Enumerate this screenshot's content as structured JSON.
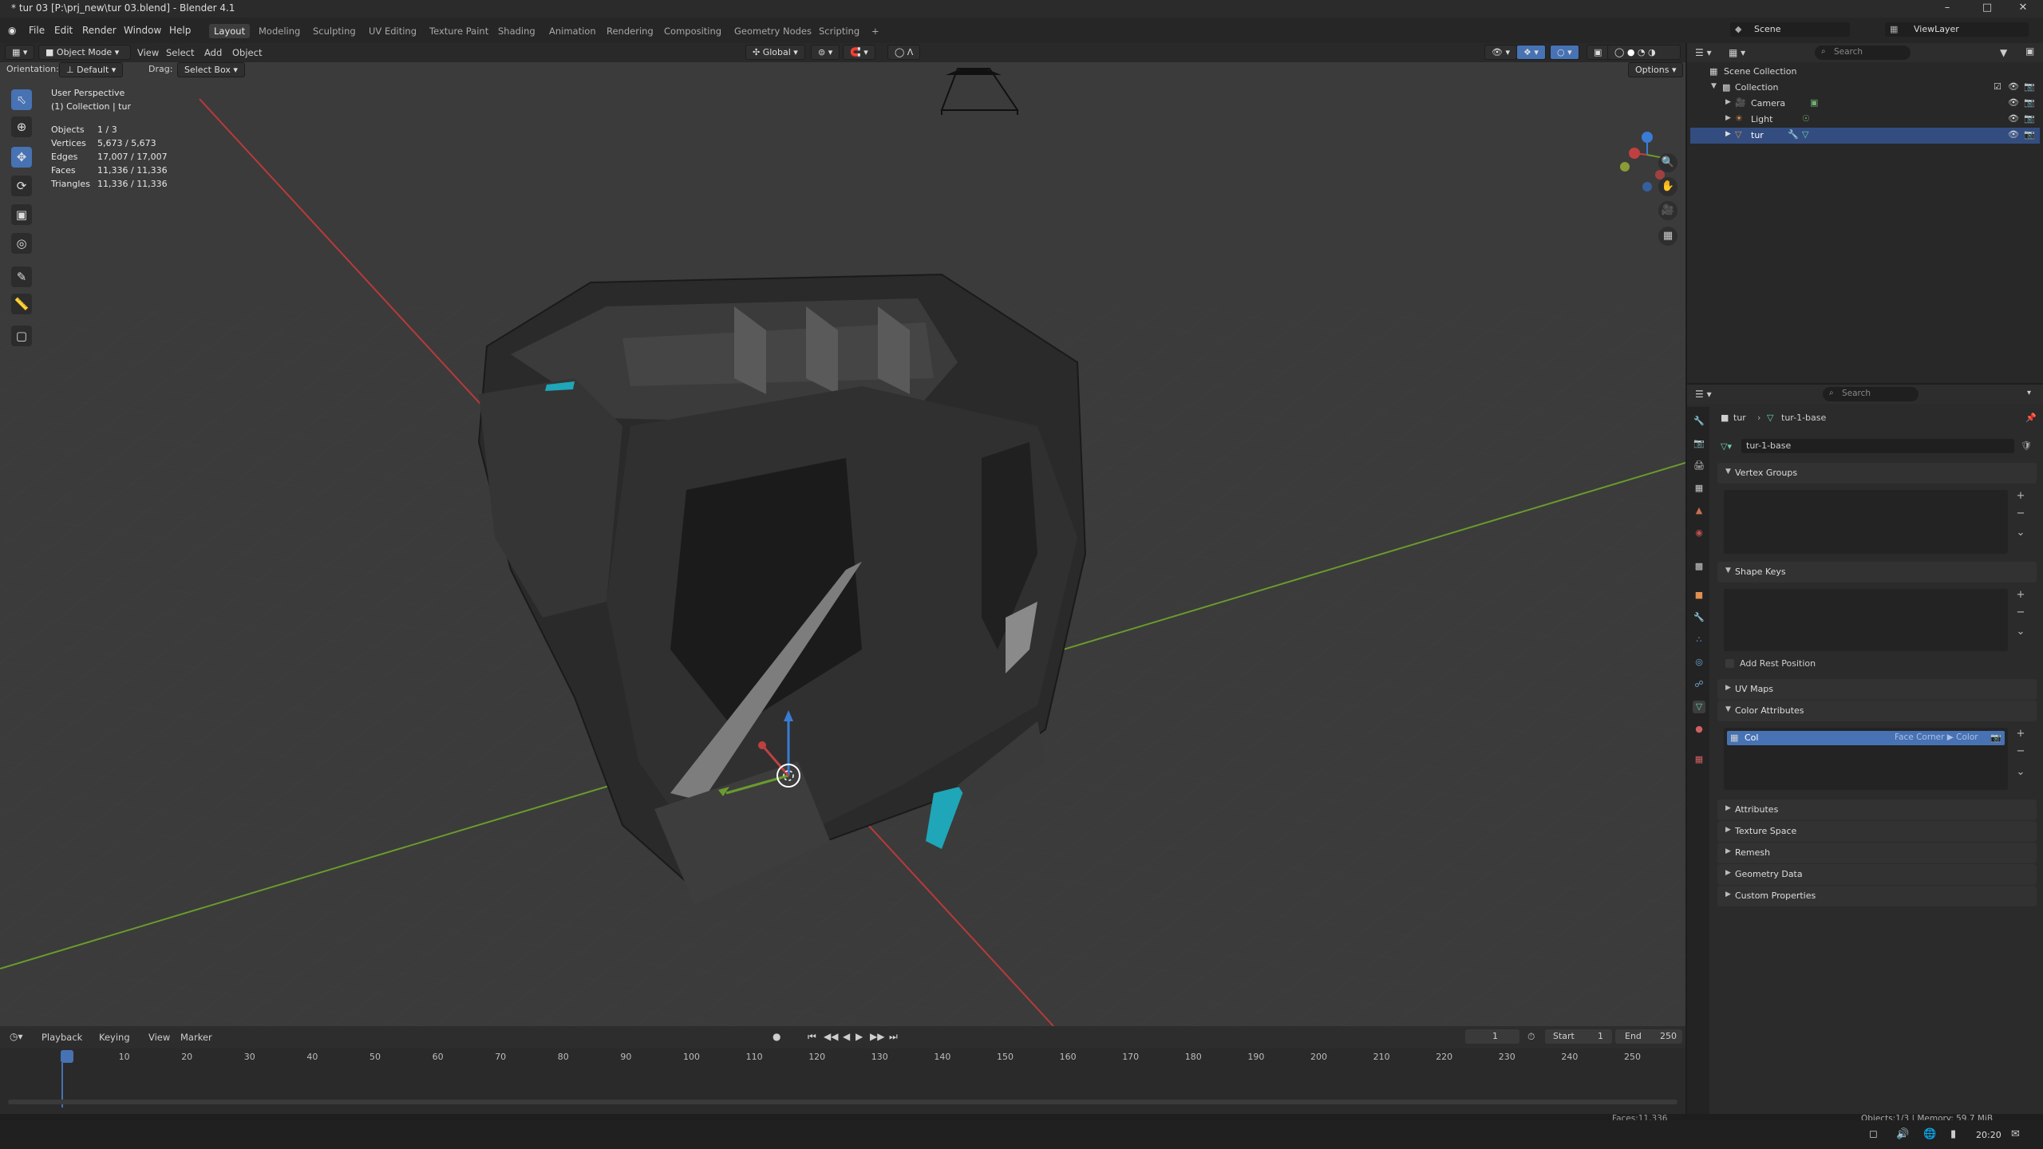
{
  "window": {
    "title": "* tur 03 [P:\\prj_new\\tur 03.blend] - Blender 4.1",
    "min_icon": "minimize-icon",
    "max_icon": "maximize-icon",
    "close_icon": "close-icon"
  },
  "menubar": {
    "menus": [
      "File",
      "Edit",
      "Render",
      "Window",
      "Help"
    ],
    "workspaces": [
      "Layout",
      "Modeling",
      "Sculpting",
      "UV Editing",
      "Texture Paint",
      "Shading",
      "Animation",
      "Rendering",
      "Compositing",
      "Geometry Nodes",
      "Scripting",
      "+"
    ],
    "active_workspace": "Layout",
    "scene": "Scene",
    "view_layer": "ViewLayer"
  },
  "viewport_header": {
    "mode": "Object Mode",
    "menus": [
      "View",
      "Select",
      "Add",
      "Object"
    ],
    "transform_orientation": "Global",
    "orientation_label": "Orientation:",
    "orientation_value": "Default",
    "drag_label": "Drag:",
    "drag_value": "Select Box",
    "options": "Options"
  },
  "viewport_overlay": {
    "view_name": "User Perspective",
    "collection_line": "(1) Collection | tur",
    "stats": [
      {
        "label": "Objects",
        "value": "1 / 3"
      },
      {
        "label": "Vertices",
        "value": "5,673 / 5,673"
      },
      {
        "label": "Edges",
        "value": "17,007 / 17,007"
      },
      {
        "label": "Faces",
        "value": "11,336 / 11,336"
      },
      {
        "label": "Triangles",
        "value": "11,336 / 11,336"
      }
    ]
  },
  "outliner": {
    "search_placeholder": "Search",
    "items": [
      {
        "label": "Scene Collection",
        "selected": false
      },
      {
        "label": "Collection",
        "selected": false
      },
      {
        "label": "Camera",
        "selected": false
      },
      {
        "label": "Light",
        "selected": false
      },
      {
        "label": "tur",
        "selected": true
      }
    ]
  },
  "properties": {
    "search_placeholder": "Search",
    "breadcrumb_object": "tur",
    "breadcrumb_mesh": "tur-1-base",
    "mesh_name": "tur-1-base",
    "panels": {
      "vertex_groups": "Vertex Groups",
      "shape_keys": "Shape Keys",
      "add_rest_position": "Add Rest Position",
      "uv_maps": "UV Maps",
      "color_attributes": "Color Attributes",
      "attributes": "Attributes",
      "texture_space": "Texture Space",
      "remesh": "Remesh",
      "geometry_data": "Geometry Data",
      "custom_properties": "Custom Properties"
    },
    "color_attribute_item": {
      "name": "Col",
      "domain": "Face Corner ▶ Color"
    }
  },
  "timeline": {
    "menus": [
      "Playback",
      "Keying",
      "View",
      "Marker"
    ],
    "current_frame": "1",
    "start_label": "Start",
    "start": "1",
    "end_label": "End",
    "end": "250",
    "ruler": [
      "1",
      "10",
      "20",
      "30",
      "40",
      "50",
      "60",
      "70",
      "80",
      "90",
      "100",
      "110",
      "120",
      "130",
      "140",
      "150",
      "160",
      "170",
      "180",
      "190",
      "200",
      "210",
      "220",
      "230",
      "240",
      "250"
    ]
  },
  "statusbar": {
    "right": "Objects:1/3 | Memory: 59.7 MiB",
    "left_partial": "Faces:11,336",
    "clock": "20:20"
  },
  "colors": {
    "accent": "#4772b3",
    "selected_row": "#334d80",
    "x_axis": "#b83a3a",
    "y_axis": "#6a9b2d",
    "teal": "#1fa6b8"
  }
}
